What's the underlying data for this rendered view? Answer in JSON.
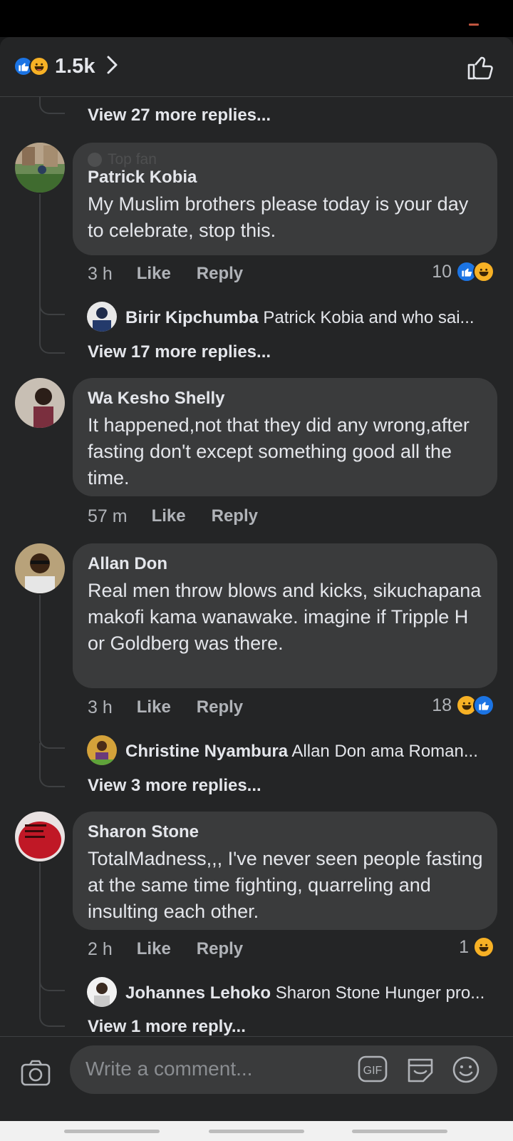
{
  "header": {
    "reaction_count": "1.5k"
  },
  "thread_top": {
    "view_more": "View 27 more replies..."
  },
  "comments": [
    {
      "badge": "Top fan",
      "author": "Patrick Kobia",
      "text": "My Muslim brothers please today is your day to celebrate, stop this.",
      "time": "3 h",
      "like": "Like",
      "reply": "Reply",
      "reactions": "10",
      "reply_preview_author": "Birir Kipchumba",
      "reply_preview_text": "Patrick Kobia and who sai...",
      "view_more": "View 17 more replies..."
    },
    {
      "author": "Wa Kesho Shelly",
      "text": "It happened,not that they did any wrong,after fasting don't except something good all the time.",
      "time": "57 m",
      "like": "Like",
      "reply": "Reply"
    },
    {
      "author": "Allan Don",
      "text": "Real men throw blows and kicks, sikuchapana makofi kama wanawake. imagine if Tripple H or Goldberg was there.",
      "time": "3 h",
      "like": "Like",
      "reply": "Reply",
      "reactions": "18",
      "reply_preview_author": "Christine Nyambura",
      "reply_preview_text": "Allan Don ama Roman...",
      "view_more": "View 3 more replies..."
    },
    {
      "author": "Sharon Stone",
      "text": "TotalMadness,,, I've never seen people fasting at the same time fighting, quarreling and insulting each other.",
      "time": "2 h",
      "like": "Like",
      "reply": "Reply",
      "reactions": "1",
      "reply_preview_author": "Johannes Lehoko",
      "reply_preview_text": "Sharon Stone Hunger pro...",
      "view_more": "View 1 more reply..."
    }
  ],
  "composer": {
    "placeholder": "Write a comment..."
  },
  "colors": {
    "like_blue": "#1b74e4",
    "haha_yellow": "#f7b125",
    "background": "#242526",
    "bubble": "#3a3b3c"
  },
  "icons": [
    "like-reaction-icon",
    "haha-reaction-icon",
    "chevron-right-icon",
    "thumbs-up-icon",
    "camera-icon",
    "gif-icon",
    "sticker-icon",
    "emoji-icon"
  ]
}
